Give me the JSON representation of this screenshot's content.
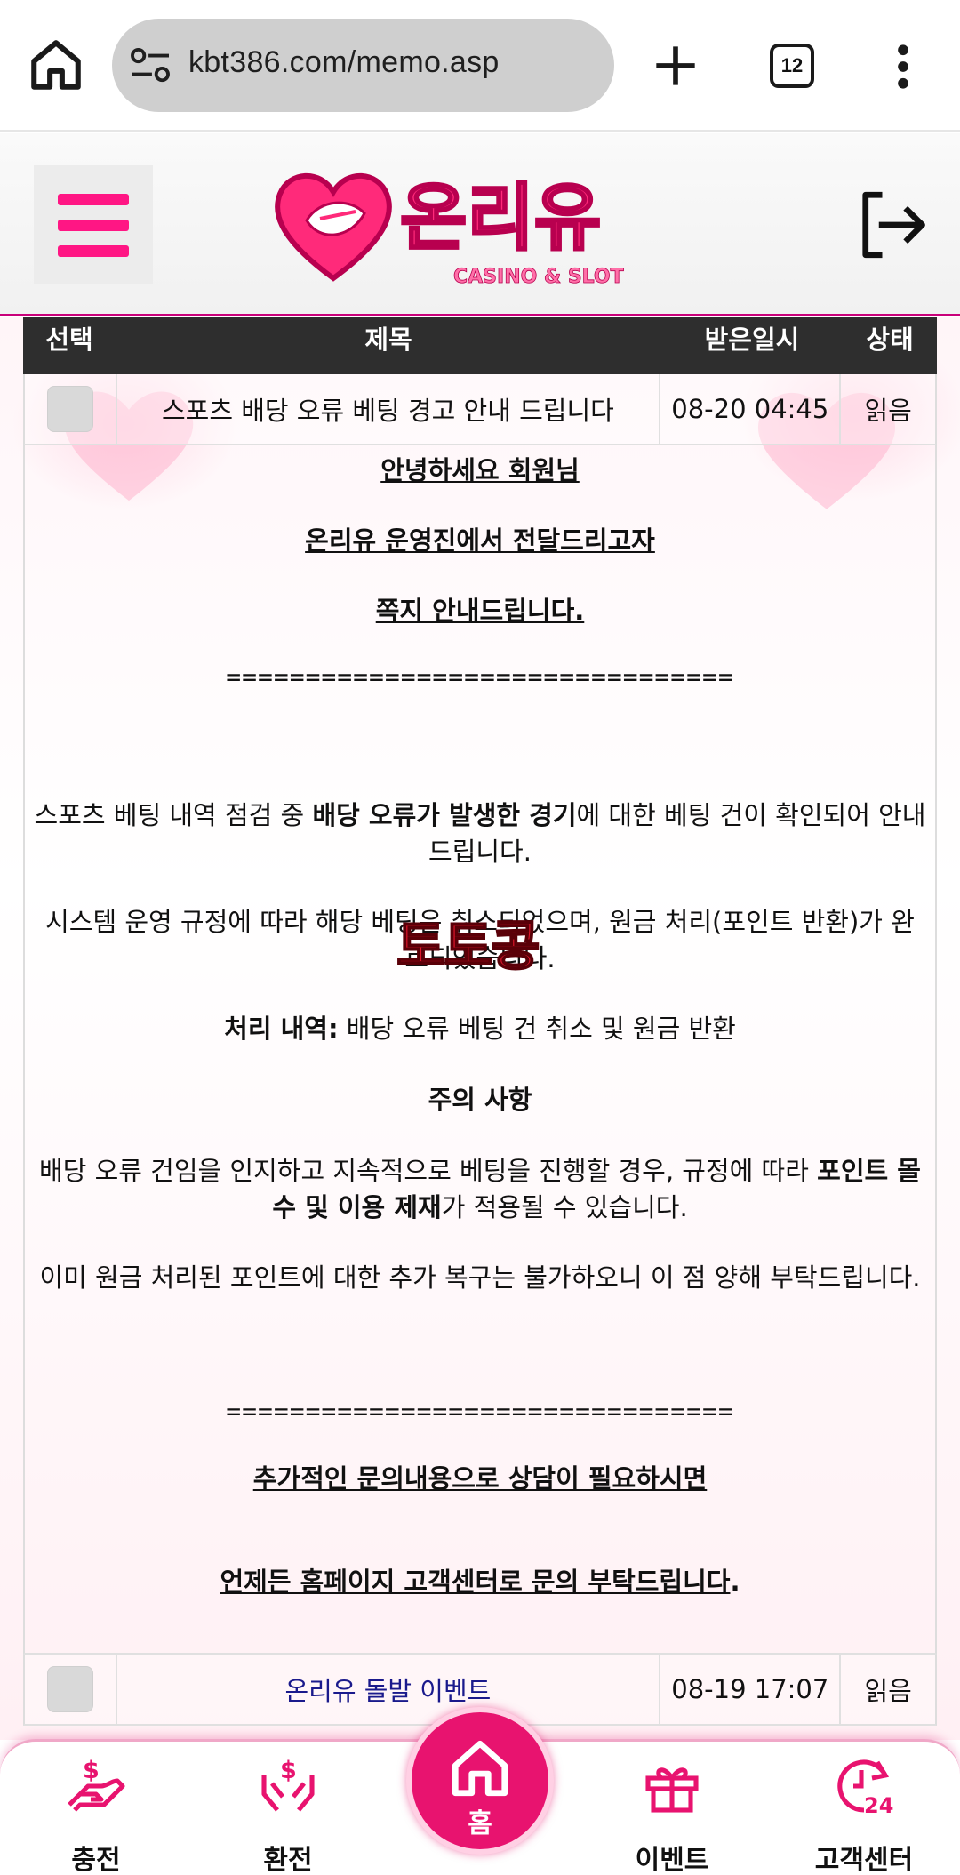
{
  "browser": {
    "url": "kbt386.com/memo.asp",
    "tab_count": "12"
  },
  "site": {
    "logo_text": "온리유",
    "logo_subtext": "CASINO & SLOT"
  },
  "table": {
    "headers": [
      "선택",
      "제목",
      "받은일시",
      "상태"
    ],
    "rows": [
      {
        "title": "스포츠 배당 오류 베팅 경고 안내 드립니다",
        "date": "08-20 04:45",
        "status": "읽음"
      },
      {
        "title": "온리유 돌발 이벤트",
        "date": "08-19 17:07",
        "status": "읽음"
      }
    ]
  },
  "memo": {
    "greeting": "안녕하세요 회원님",
    "intro1": "온리유 운영진에서 전달드리고자",
    "intro2": "쪽지 안내드립니다.",
    "separator": "================================",
    "para1_pre": "스포츠 베팅 내역 점검 중 ",
    "para1_bold": "배당 오류가 발생한 경기",
    "para1_post": "에 대한 베팅 건이 확인되어 안내드립니다.",
    "para2": "시스템 운영 규정에 따라 해당 베팅은 취소되었으며, 원금 처리(포인트 반환)가 완료되었습니다.",
    "process_label": "처리 내역:",
    "process_text": " 배당 오류 베팅 건 취소 및 원금 반환",
    "caution_title": "주의 사항",
    "caution_pre": "배당 오류 건임을 인지하고 지속적으로 베팅을 진행할 경우, 규정에 따라 ",
    "caution_bold": "포인트 몰수 및 이용 제재",
    "caution_post": "가 적용될 수 있습니다.",
    "para3": "이미 원금 처리된 포인트에 대한 추가 복구는 불가하오니 이 점 양해 부탁드립니다.",
    "contact1": "추가적인 문의내용으로 상담이 필요하시면 ",
    "contact2": "언제든 홈페이지 고객센터로 문의 부탁드립니다",
    "contact2_end": "."
  },
  "watermark": "토토콩",
  "bottom_nav": {
    "charge": "충전",
    "exchange": "환전",
    "home": "홈",
    "event": "이벤트",
    "support": "고객센터"
  },
  "colors": {
    "accent": "#e8136f",
    "header_dark": "#2e2e2e"
  }
}
